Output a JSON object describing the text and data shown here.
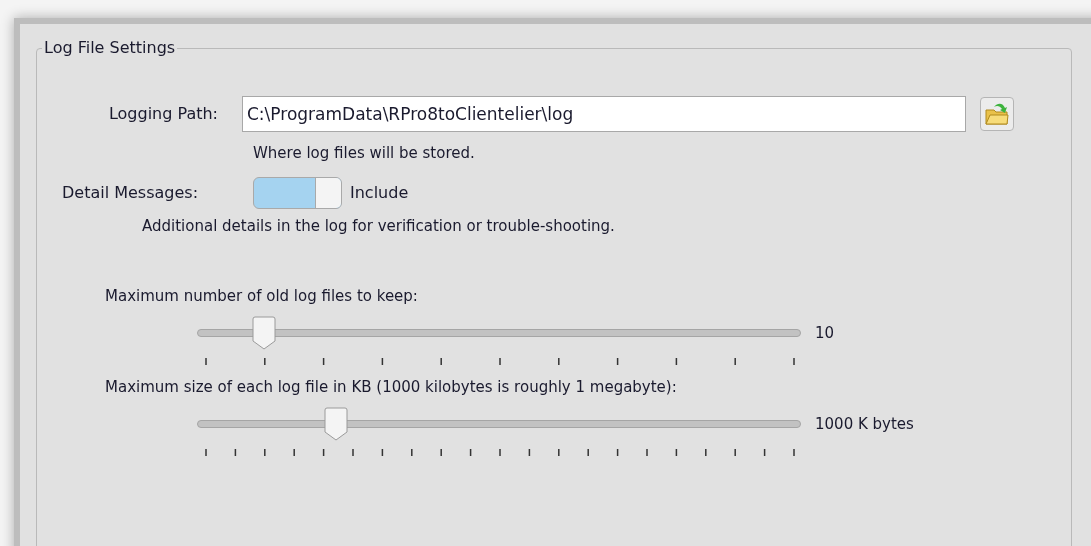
{
  "group": {
    "title": "Log File Settings"
  },
  "logging_path": {
    "label": "Logging Path:",
    "value": "C:\\ProgramData\\RPro8toClientelier\\log",
    "hint": "Where log files will be stored."
  },
  "detail_messages": {
    "label": "Detail Messages:",
    "on": true,
    "state_label": "Include",
    "description": "Additional details in the log for verification or trouble-shooting."
  },
  "sliders": [
    {
      "label": "Maximum number of old log files to keep:",
      "level": 0.11,
      "reading": "10"
    },
    {
      "label": "Maximum size of each log file in KB  (1000 kilobytes is roughly 1 megabyte):",
      "level": 0.23,
      "reading": "1000 K bytes"
    }
  ]
}
